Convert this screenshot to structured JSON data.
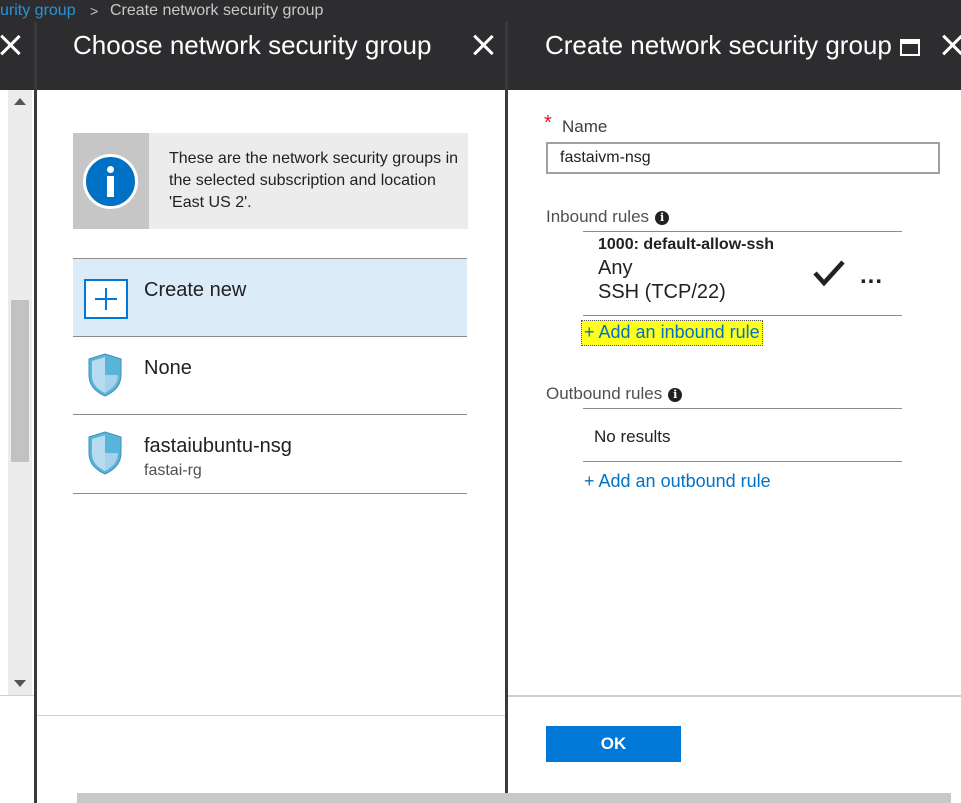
{
  "breadcrumb": {
    "link": "urity group",
    "separator": ">",
    "current": "Create network security group"
  },
  "left_blade": {
    "close_icon": "close-icon"
  },
  "choose_blade": {
    "title": "Choose network security group",
    "info_text": "These are the network security groups in the selected subscription and location 'East US 2'.",
    "items": [
      {
        "label": "Create new",
        "icon": "plus-icon",
        "selected": true
      },
      {
        "label": "None",
        "icon": "shield-icon"
      },
      {
        "label": "fastaiubuntu-nsg",
        "sublabel": "fastai-rg",
        "icon": "shield-icon"
      }
    ]
  },
  "create_blade": {
    "title": "Create network security group",
    "name_label": "Name",
    "name_value": "fastaivm-nsg",
    "required_mark": "*",
    "inbound_label": "Inbound rules",
    "inbound_rule": {
      "name": "1000: default-allow-ssh",
      "source": "Any",
      "service": "SSH (TCP/22)",
      "more": "..."
    },
    "add_inbound": "+ Add an inbound rule",
    "outbound_label": "Outbound rules",
    "outbound_empty": "No results",
    "add_outbound": "+ Add an outbound rule",
    "ok_label": "OK"
  },
  "colors": {
    "header_bg": "#2d2d30",
    "accent_blue": "#0078d7",
    "selected_row": "#dcebf8",
    "highlight": "#ffff1a"
  }
}
